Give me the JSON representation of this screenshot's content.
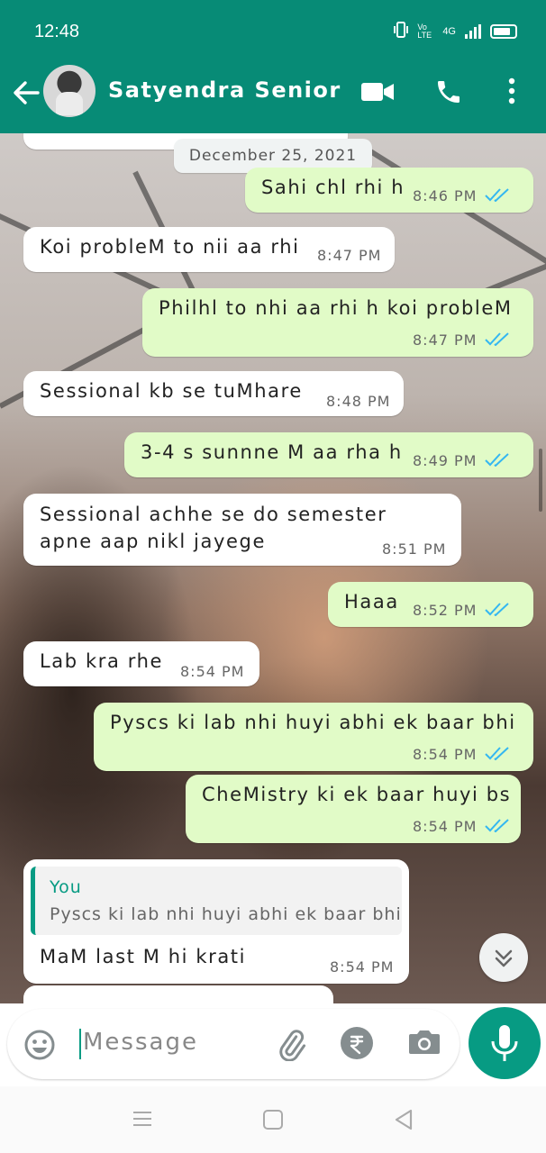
{
  "status_bar": {
    "time": "12:48",
    "network": "4G",
    "volte": "Vo LTE"
  },
  "header": {
    "contact_name": "Satyendra Senior"
  },
  "date_chip": "December 25, 2021",
  "messages": [
    {
      "direction": "out",
      "text": "Sahi chl rhi h",
      "time": "8:46 PM",
      "read": true
    },
    {
      "direction": "in",
      "text": "Koi probleM to nii aa rhi",
      "time": "8:47 PM"
    },
    {
      "direction": "out",
      "text": "Philhl to nhi aa rhi h koi probleM",
      "time": "8:47 PM",
      "read": true
    },
    {
      "direction": "in",
      "text": "Sessional kb se tuMhare",
      "time": "8:48 PM"
    },
    {
      "direction": "out",
      "text": "3-4 s sunnne M aa rha h",
      "time": "8:49 PM",
      "read": true
    },
    {
      "direction": "in",
      "line1": "Sessional achhe se do  semester",
      "line2": "apne aap nikl jayege",
      "time": "8:51 PM"
    },
    {
      "direction": "out",
      "text": "Haaa",
      "time": "8:52 PM",
      "read": true
    },
    {
      "direction": "in",
      "text": "Lab kra rhe",
      "time": "8:54 PM"
    },
    {
      "direction": "out",
      "text": "Pyscs ki lab nhi huyi abhi ek baar bhi",
      "time": "8:54 PM",
      "read": true
    },
    {
      "direction": "out",
      "text": "CheMistry ki ek baar huyi bs",
      "time": "8:54 PM",
      "read": true
    },
    {
      "direction": "in",
      "quote_author": "You",
      "quote_text": "Pyscs ki lab nhi huyi abhi ek baar bhi",
      "text": "MaM last M hi krati",
      "time": "8:54 PM"
    }
  ],
  "composer": {
    "placeholder": "Message"
  },
  "colors": {
    "primary": "#078b76",
    "accent": "#079b83",
    "outgoing": "#e1fbc7",
    "incoming": "#ffffff",
    "read_tick": "#34b7f1"
  }
}
